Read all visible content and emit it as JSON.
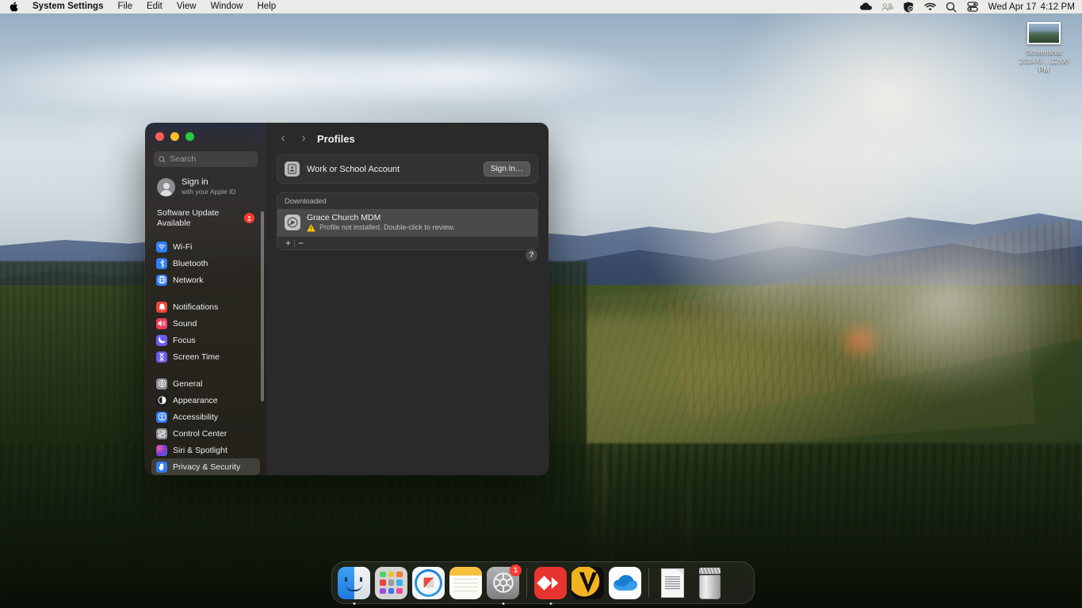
{
  "menubar": {
    "apple_icon": "apple-logo-icon",
    "items": [
      {
        "label": "System Settings",
        "bold": true
      },
      {
        "label": "File",
        "bold": false
      },
      {
        "label": "Edit",
        "bold": false
      },
      {
        "label": "View",
        "bold": false
      },
      {
        "label": "Window",
        "bold": false
      },
      {
        "label": "Help",
        "bold": false
      }
    ],
    "status_icons": [
      "cloud-icon",
      "screen-sharing-icon",
      "vpn-shield-icon",
      "wifi-icon",
      "spotlight-search-icon",
      "control-center-icon"
    ],
    "date": "Wed Apr 17",
    "time": "4:12 PM"
  },
  "desktop": {
    "icon": {
      "name": "screenshot-file-icon",
      "label_line1": "Screenshot",
      "label_line2": "2024-0….12.00 PM"
    }
  },
  "window": {
    "traffic_lights": {
      "close": "close-button",
      "minimize": "minimize-button",
      "zoom": "zoom-button"
    },
    "sidebar": {
      "search": {
        "placeholder": "Search",
        "value": ""
      },
      "account": {
        "title": "Sign in",
        "subtitle": "with your Apple ID"
      },
      "update": {
        "label": "Software Update Available",
        "badge": "1"
      },
      "groups": [
        {
          "items": [
            {
              "label": "Wi-Fi",
              "icon": "wifi-icon",
              "color": "#2f7cf6",
              "selected": false
            },
            {
              "label": "Bluetooth",
              "icon": "bluetooth-icon",
              "color": "#2f7cf6",
              "selected": false
            },
            {
              "label": "Network",
              "icon": "network-globe-icon",
              "color": "#2f7cf6",
              "selected": false
            }
          ]
        },
        {
          "items": [
            {
              "label": "Notifications",
              "icon": "bell-icon",
              "color": "#f0433a",
              "selected": false
            },
            {
              "label": "Sound",
              "icon": "speaker-icon",
              "color": "#ef3b5b",
              "selected": false
            },
            {
              "label": "Focus",
              "icon": "moon-icon",
              "color": "#6b5cf0",
              "selected": false
            },
            {
              "label": "Screen Time",
              "icon": "hourglass-icon",
              "color": "#6b5cf0",
              "selected": false
            }
          ]
        },
        {
          "items": [
            {
              "label": "General",
              "icon": "gear-icon",
              "color": "#8e8e93",
              "selected": false
            },
            {
              "label": "Appearance",
              "icon": "contrast-circle-icon",
              "color": "#1c1c1e",
              "selected": false
            },
            {
              "label": "Accessibility",
              "icon": "accessibility-icon",
              "color": "#2f7cf6",
              "selected": false
            },
            {
              "label": "Control Center",
              "icon": "control-center-icon",
              "color": "#8e8e93",
              "selected": false
            },
            {
              "label": "Siri & Spotlight",
              "icon": "siri-icon",
              "color": "#c23aa8",
              "selected": false
            },
            {
              "label": "Privacy & Security",
              "icon": "hand-raised-icon",
              "color": "#2f7cf6",
              "selected": true
            }
          ]
        }
      ]
    },
    "detail": {
      "nav": {
        "back": "back-arrow-icon",
        "forward": "forward-arrow-icon"
      },
      "title": "Profiles",
      "account_card": {
        "icon": "id-card-icon",
        "label": "Work or School Account",
        "button": "Sign In…"
      },
      "list": {
        "header": "Downloaded",
        "rows": [
          {
            "icon": "mdm-profile-icon",
            "name": "Grace Church MDM",
            "status_icon": "warning-triangle-icon",
            "status": "Profile not installed. Double-click to review.",
            "selected": true
          }
        ],
        "footer": {
          "add": "+",
          "remove": "−"
        }
      },
      "help_button": "?"
    }
  },
  "dock": {
    "items": [
      {
        "name": "finder",
        "badge": "",
        "running": true
      },
      {
        "name": "launchpad",
        "badge": "",
        "running": false
      },
      {
        "name": "safari",
        "badge": "",
        "running": false
      },
      {
        "name": "notes",
        "badge": "",
        "running": false
      },
      {
        "name": "system-settings",
        "badge": "1",
        "running": true
      },
      {
        "sep": true
      },
      {
        "name": "anydesk",
        "badge": "",
        "running": true
      },
      {
        "name": "vlc",
        "badge": "",
        "running": false
      },
      {
        "name": "onedrive",
        "badge": "",
        "running": false
      },
      {
        "sep": true
      },
      {
        "name": "document-file",
        "badge": "",
        "running": false
      },
      {
        "name": "trash",
        "badge": "",
        "running": false
      }
    ]
  }
}
